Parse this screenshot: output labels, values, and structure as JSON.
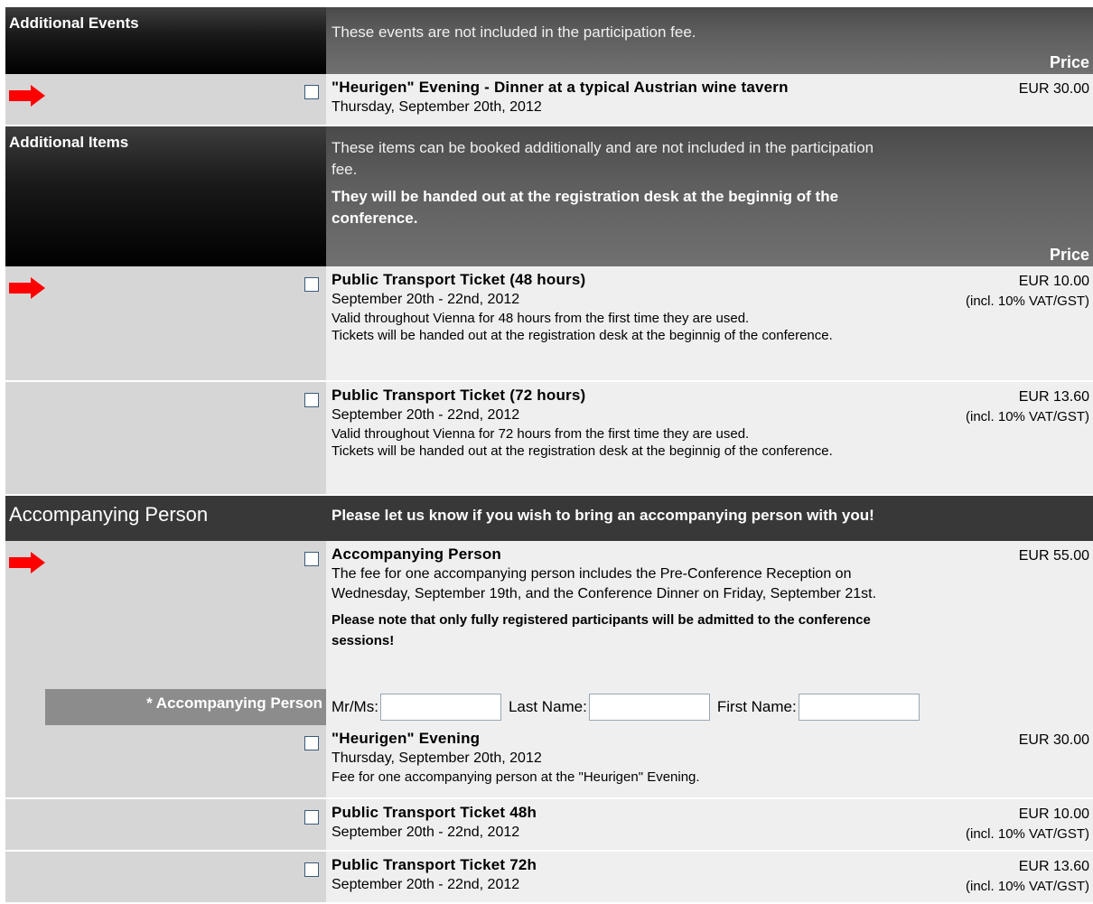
{
  "additional_events": {
    "heading": "Additional Events",
    "description": "These events are not included in the participation fee.",
    "price_header": "Price",
    "items": [
      {
        "title": "\"Heurigen\" Evening - Dinner at a typical Austrian wine tavern",
        "date": "Thursday, September 20th, 2012",
        "price": "EUR 30.00"
      }
    ]
  },
  "additional_items": {
    "heading": "Additional Items",
    "description": "These items can be booked additionally and are not included in the participation fee.",
    "note": "They will be handed out at the registration desk at the beginnig of the conference.",
    "price_header": "Price",
    "items": [
      {
        "title": "Public Transport Ticket (48 hours)",
        "date": "September 20th - 22nd, 2012",
        "desc1": "Valid throughout Vienna for 48 hours from the first time they are used.",
        "desc2": "Tickets will be handed out at the registration desk at the beginnig of the conference.",
        "price": "EUR 10.00",
        "vat": "(incl. 10% VAT/GST)"
      },
      {
        "title": "Public Transport Ticket (72 hours)",
        "date": "September 20th - 22nd, 2012",
        "desc1": "Valid throughout Vienna for 72 hours from the first time they are used.",
        "desc2": "Tickets will be handed out at the registration desk at the beginnig of the conference.",
        "price": "EUR 13.60",
        "vat": "(incl. 10% VAT/GST)"
      }
    ]
  },
  "accompanying": {
    "heading": "Accompanying Person",
    "description": "Please let us know if you wish to bring an accompanying person with you!",
    "main_item": {
      "title": "Accompanying Person",
      "desc": "The fee for one accompanying person includes the Pre-Conference Reception on Wednesday, September 19th, and the Conference Dinner on Friday, September 21st.",
      "note": "Please note that only fully registered participants will be admitted to the conference sessions!",
      "price": "EUR 55.00"
    },
    "field_label": "* Accompanying Person",
    "mr_ms_label": "Mr/Ms:",
    "last_name_label": "Last Name:",
    "first_name_label": "First Name:",
    "extras": [
      {
        "title": "\"Heurigen\" Evening",
        "date": "Thursday, September 20th, 2012",
        "desc": "Fee for one accompanying person at the \"Heurigen\" Evening.",
        "price": "EUR 30.00"
      },
      {
        "title": "Public Transport Ticket 48h",
        "date": "September 20th - 22nd, 2012",
        "price": "EUR 10.00",
        "vat": "(incl. 10% VAT/GST)"
      },
      {
        "title": "Public Transport Ticket 72h",
        "date": "September 20th - 22nd, 2012",
        "price": "EUR 13.60",
        "vat": "(incl. 10% VAT/GST)"
      }
    ]
  },
  "colors": {
    "arrow": "#ff0000",
    "section_dark": "#383838",
    "row_bg": "#efefef",
    "left_bg": "#d6d6d6"
  },
  "icons": {
    "arrow": "red-arrow-icon",
    "checkbox": "checkbox"
  }
}
